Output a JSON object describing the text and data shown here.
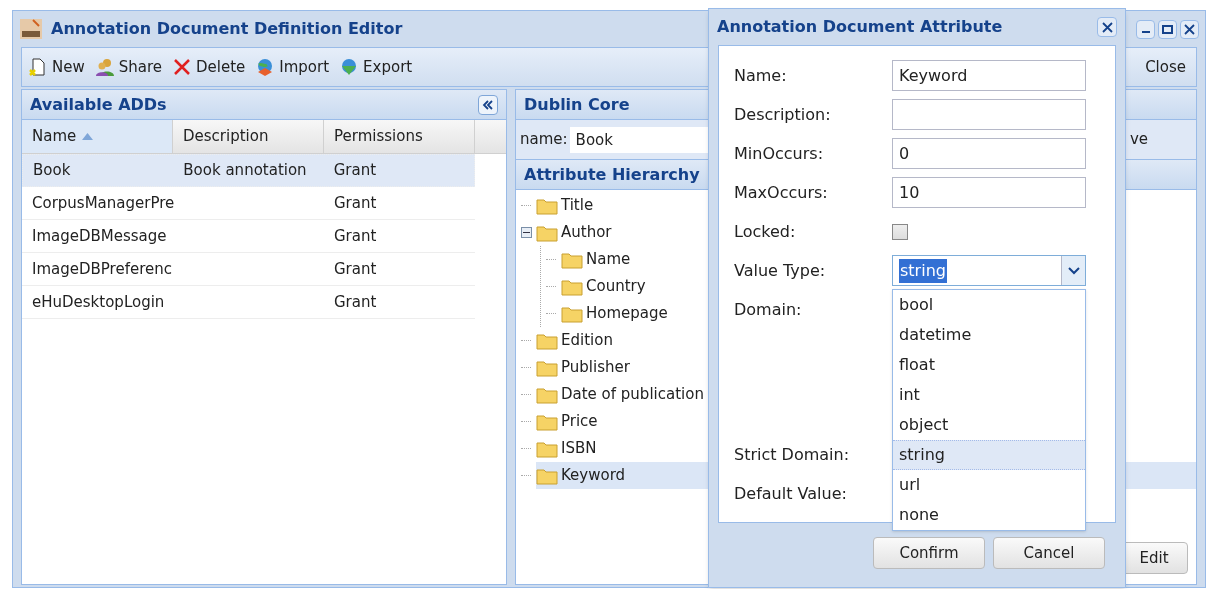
{
  "window": {
    "title": "Annotation Document Definition Editor",
    "close_label": "Close"
  },
  "toolbar": [
    {
      "kind": "new",
      "label": "New"
    },
    {
      "kind": "share",
      "label": "Share"
    },
    {
      "kind": "delete",
      "label": "Delete"
    },
    {
      "kind": "import",
      "label": "Import"
    },
    {
      "kind": "export",
      "label": "Export"
    }
  ],
  "left_panel": {
    "title": "Available ADDs",
    "table": {
      "columns": [
        {
          "label": "Name",
          "sorted": true
        },
        {
          "label": "Description",
          "sorted": false
        },
        {
          "label": "Permissions",
          "sorted": false
        }
      ],
      "rows": [
        {
          "selected": true,
          "cells": [
            "Book",
            "Book annotation",
            "Grant"
          ]
        },
        {
          "selected": false,
          "cells": [
            "CorpusManagerPre",
            "",
            "Grant"
          ]
        },
        {
          "selected": false,
          "cells": [
            "ImageDBMessage",
            "",
            "Grant"
          ]
        },
        {
          "selected": false,
          "cells": [
            "ImageDBPreferenc",
            "",
            "Grant"
          ]
        },
        {
          "selected": false,
          "cells": [
            "eHuDesktopLogin",
            "",
            "Grant"
          ]
        }
      ]
    }
  },
  "right_panel": {
    "title": "Dublin Core",
    "name_label": "name:",
    "name_value": "Book",
    "save_fragment": "ve",
    "hierarchy_title": "Attribute Hierarchy",
    "edit_label": "Edit",
    "tree": [
      {
        "label": "Title",
        "selected": false
      },
      {
        "label": "Author",
        "selected": false,
        "expanded": true,
        "children": [
          {
            "label": "Name",
            "selected": false
          },
          {
            "label": "Country",
            "selected": false
          },
          {
            "label": "Homepage",
            "selected": false
          }
        ]
      },
      {
        "label": "Edition",
        "selected": false
      },
      {
        "label": "Publisher",
        "selected": false
      },
      {
        "label": "Date of publication",
        "selected": false
      },
      {
        "label": "Price",
        "selected": false
      },
      {
        "label": "ISBN",
        "selected": false
      },
      {
        "label": "Keyword",
        "selected": true
      }
    ]
  },
  "dialog": {
    "title": "Annotation Document Attribute",
    "fields": [
      {
        "kind": "text",
        "label": "Name:",
        "value": "Keyword"
      },
      {
        "kind": "text",
        "label": "Description:"
      },
      {
        "kind": "text",
        "label": "MinOccurs:",
        "value": "0"
      },
      {
        "kind": "text",
        "label": "MaxOccurs:",
        "value": "10"
      },
      {
        "kind": "checkbox",
        "label": "Locked:",
        "checked": false
      },
      {
        "kind": "select",
        "label": "Value Type:",
        "value": "string",
        "expanded": true,
        "options": [
          {
            "label": "bool",
            "selected": false
          },
          {
            "label": "datetime",
            "selected": false
          },
          {
            "label": "float",
            "selected": false
          },
          {
            "label": "int",
            "selected": false
          },
          {
            "label": "object",
            "selected": false
          },
          {
            "label": "string",
            "selected": true
          },
          {
            "label": "url",
            "selected": false
          },
          {
            "label": "none",
            "selected": false
          }
        ]
      },
      {
        "kind": "area",
        "label": "Domain:"
      },
      {
        "kind": "blank",
        "label": "Strict Domain:"
      },
      {
        "kind": "blank",
        "label": "Default Value:"
      }
    ],
    "buttons": [
      "Confirm",
      "Cancel"
    ]
  }
}
